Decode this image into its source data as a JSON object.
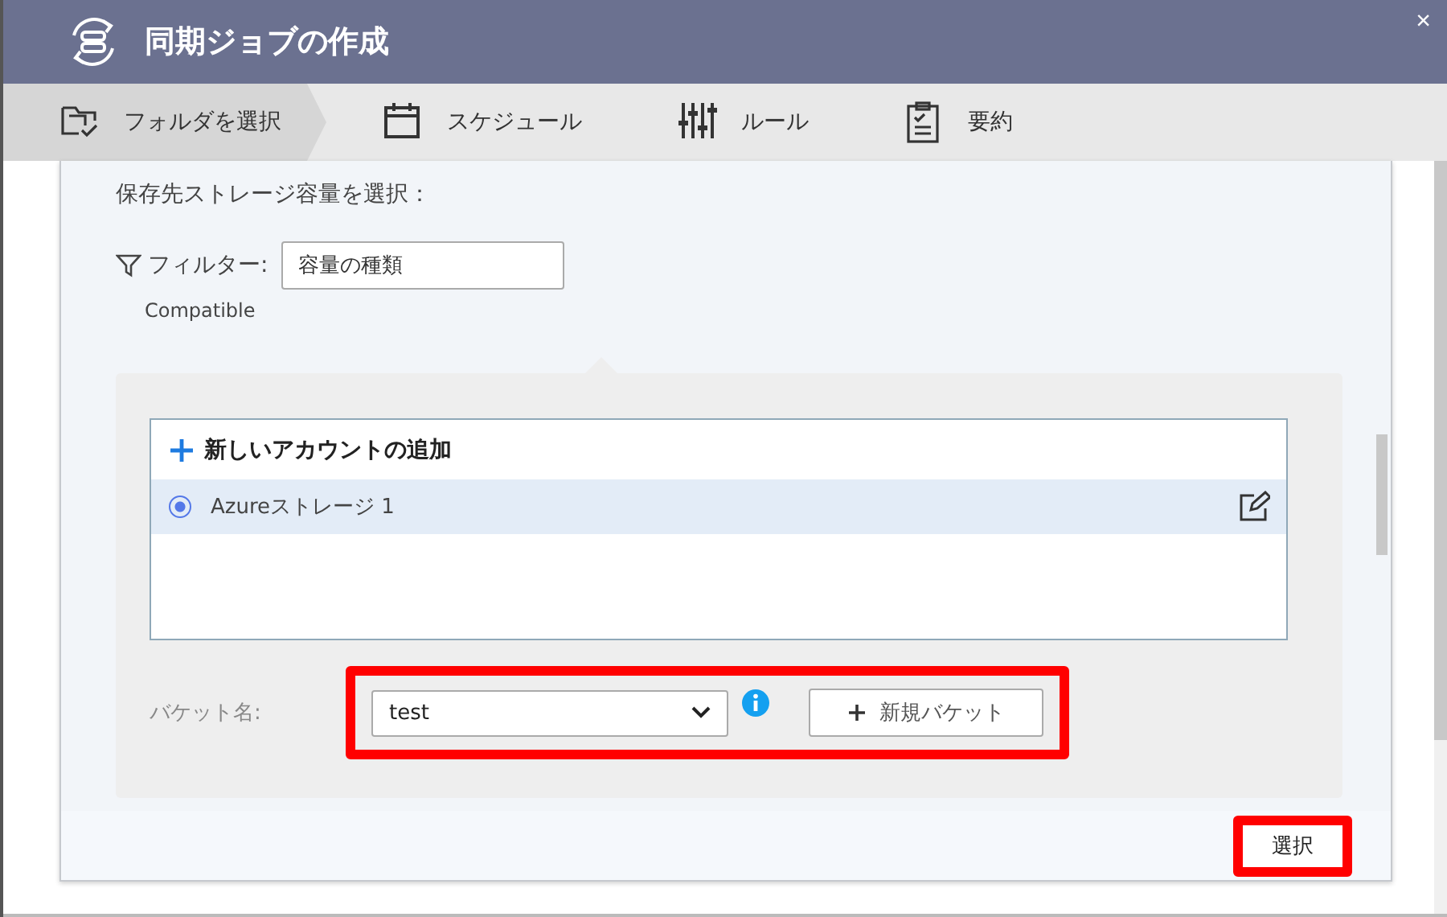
{
  "window": {
    "title": "同期ジョブの作成",
    "close": "×"
  },
  "steps": [
    {
      "label": "フォルダを選択",
      "kind": "folder",
      "selected": true
    },
    {
      "label": "スケジュール",
      "kind": "calendar",
      "selected": false
    },
    {
      "label": "ルール",
      "kind": "sliders",
      "selected": false
    },
    {
      "label": "要約",
      "kind": "clipboard",
      "selected": false
    }
  ],
  "panel": {
    "heading": "保存先ストレージ容量を選択：",
    "filter": {
      "label": "フィルター:",
      "value": "容量の種類",
      "note": "Compatible"
    },
    "accounts": {
      "add_label": "新しいアカウントの追加",
      "items": [
        {
          "name": "Azureストレージ 1",
          "selected": true
        }
      ]
    },
    "bucket": {
      "label": "バケット名:",
      "value": "test",
      "new_button": "新規バケット",
      "highlighted": true
    },
    "select_button": {
      "label": "選択",
      "highlighted": true
    }
  }
}
